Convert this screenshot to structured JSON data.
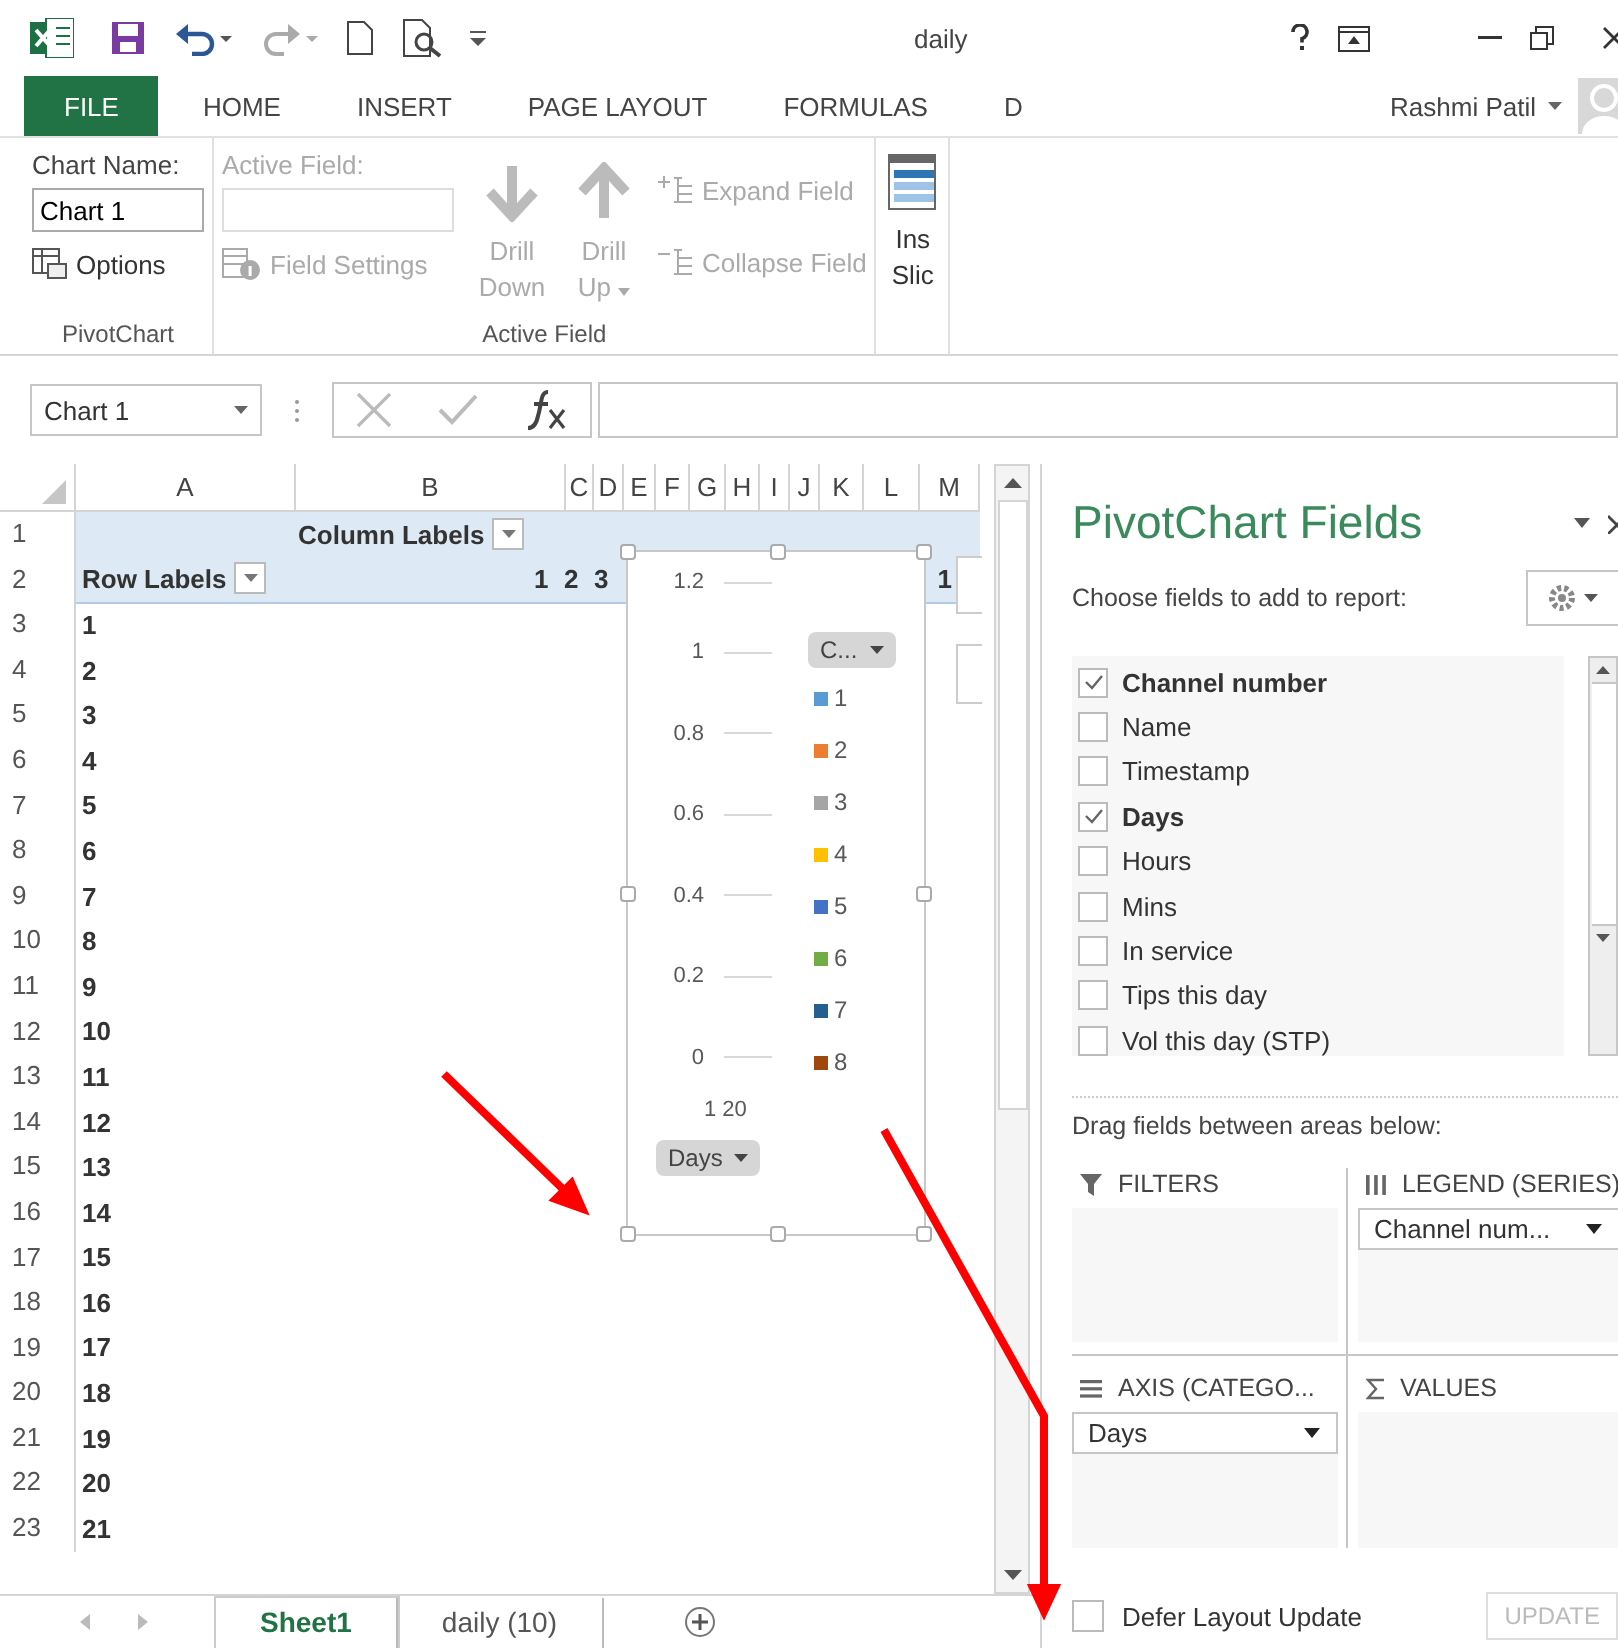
{
  "title_bar": {
    "title": "daily"
  },
  "ribbon_tabs": [
    {
      "label": "FILE",
      "selected": true
    },
    {
      "label": "HOME",
      "selected": false
    },
    {
      "label": "INSERT",
      "selected": false
    },
    {
      "label": "PAGE LAYOUT",
      "selected": false
    },
    {
      "label": "FORMULAS",
      "selected": false
    },
    {
      "label": "D",
      "selected": false
    }
  ],
  "account": {
    "user_name": "Rashmi Patil"
  },
  "ribbon": {
    "pivotchart": {
      "chart_name_label": "Chart Name:",
      "chart_name": "Chart 1",
      "options_button": "Options",
      "group_label": "PivotChart"
    },
    "active_field": {
      "label": "Active Field:",
      "input_disabled": true,
      "field_settings": {
        "label": "Field Settings",
        "disabled": true
      },
      "drill_down": {
        "label": "Drill Down",
        "disabled": true
      },
      "drill_up": {
        "label": "Drill Up",
        "disabled": true
      },
      "expand_field": {
        "label": "Expand Field",
        "disabled": true
      },
      "collapse_field": {
        "label": "Collapse Field",
        "disabled": true
      },
      "group_label": "Active Field"
    },
    "insert_slicer": {
      "label": "Ins Slic"
    }
  },
  "formula_bar": {
    "name_box": "Chart 1"
  },
  "sheet": {
    "columns": [
      "A",
      "B",
      "C",
      "D",
      "E",
      "F",
      "G",
      "H",
      "I",
      "J",
      "K",
      "L",
      "M"
    ],
    "row_numbers": [
      "1",
      "2",
      "3",
      "4",
      "5",
      "6",
      "7",
      "8",
      "9",
      "10",
      "11",
      "12",
      "13",
      "14",
      "15",
      "16",
      "17",
      "18",
      "19",
      "20",
      "21",
      "22",
      "23"
    ],
    "pivot": {
      "column_labels": "Column Labels",
      "row_labels": "Row Labels",
      "column_items": [
        "1",
        "2",
        "3"
      ],
      "last_column_item": "1",
      "row_items": [
        "1",
        "2",
        "3",
        "4",
        "5",
        "6",
        "7",
        "8",
        "9",
        "10",
        "11",
        "12",
        "13",
        "14",
        "15",
        "16",
        "17",
        "18",
        "19",
        "20",
        "21"
      ]
    }
  },
  "chart": {
    "y_ticks": [
      "1.2",
      "1",
      "0.8",
      "0.6",
      "0.4",
      "0.2",
      "0"
    ],
    "x_label": "1 20",
    "legend_button": "C...",
    "legend": [
      {
        "label": "1",
        "color": "#5b9bd5"
      },
      {
        "label": "2",
        "color": "#ed7d31"
      },
      {
        "label": "3",
        "color": "#a5a5a5"
      },
      {
        "label": "4",
        "color": "#ffc000"
      },
      {
        "label": "5",
        "color": "#4472c4"
      },
      {
        "label": "6",
        "color": "#70ad47"
      },
      {
        "label": "7",
        "color": "#255e91"
      },
      {
        "label": "8",
        "color": "#9e480e"
      }
    ],
    "axis_button": "Days"
  },
  "field_pane": {
    "title": "PivotChart Fields",
    "prompt": "Choose fields to add to report:",
    "fields": [
      {
        "label": "Channel number",
        "checked": true
      },
      {
        "label": "Name",
        "checked": false
      },
      {
        "label": "Timestamp",
        "checked": false
      },
      {
        "label": "Days",
        "checked": true
      },
      {
        "label": "Hours",
        "checked": false
      },
      {
        "label": "Mins",
        "checked": false
      },
      {
        "label": "In service",
        "checked": false
      },
      {
        "label": "Tips this day",
        "checked": false
      },
      {
        "label": "Vol this day (STP)",
        "checked": false
      }
    ],
    "drag_prompt": "Drag fields between areas below:",
    "areas": [
      {
        "kind": "filters",
        "title": "FILTERS"
      },
      {
        "kind": "legend",
        "title": "LEGEND (SERIES)",
        "items": [
          "Channel num..."
        ]
      },
      {
        "kind": "axis",
        "title": "AXIS (CATEGO...",
        "items": [
          "Days"
        ]
      },
      {
        "kind": "values",
        "title": "VALUES"
      }
    ],
    "defer_update": {
      "label": "Defer Layout Update",
      "checked": false
    },
    "update_button": {
      "label": "UPDATE",
      "disabled": true
    }
  },
  "sheet_tabs": [
    {
      "label": "Sheet1",
      "selected": true
    },
    {
      "label": "daily (10)",
      "selected": false
    }
  ]
}
